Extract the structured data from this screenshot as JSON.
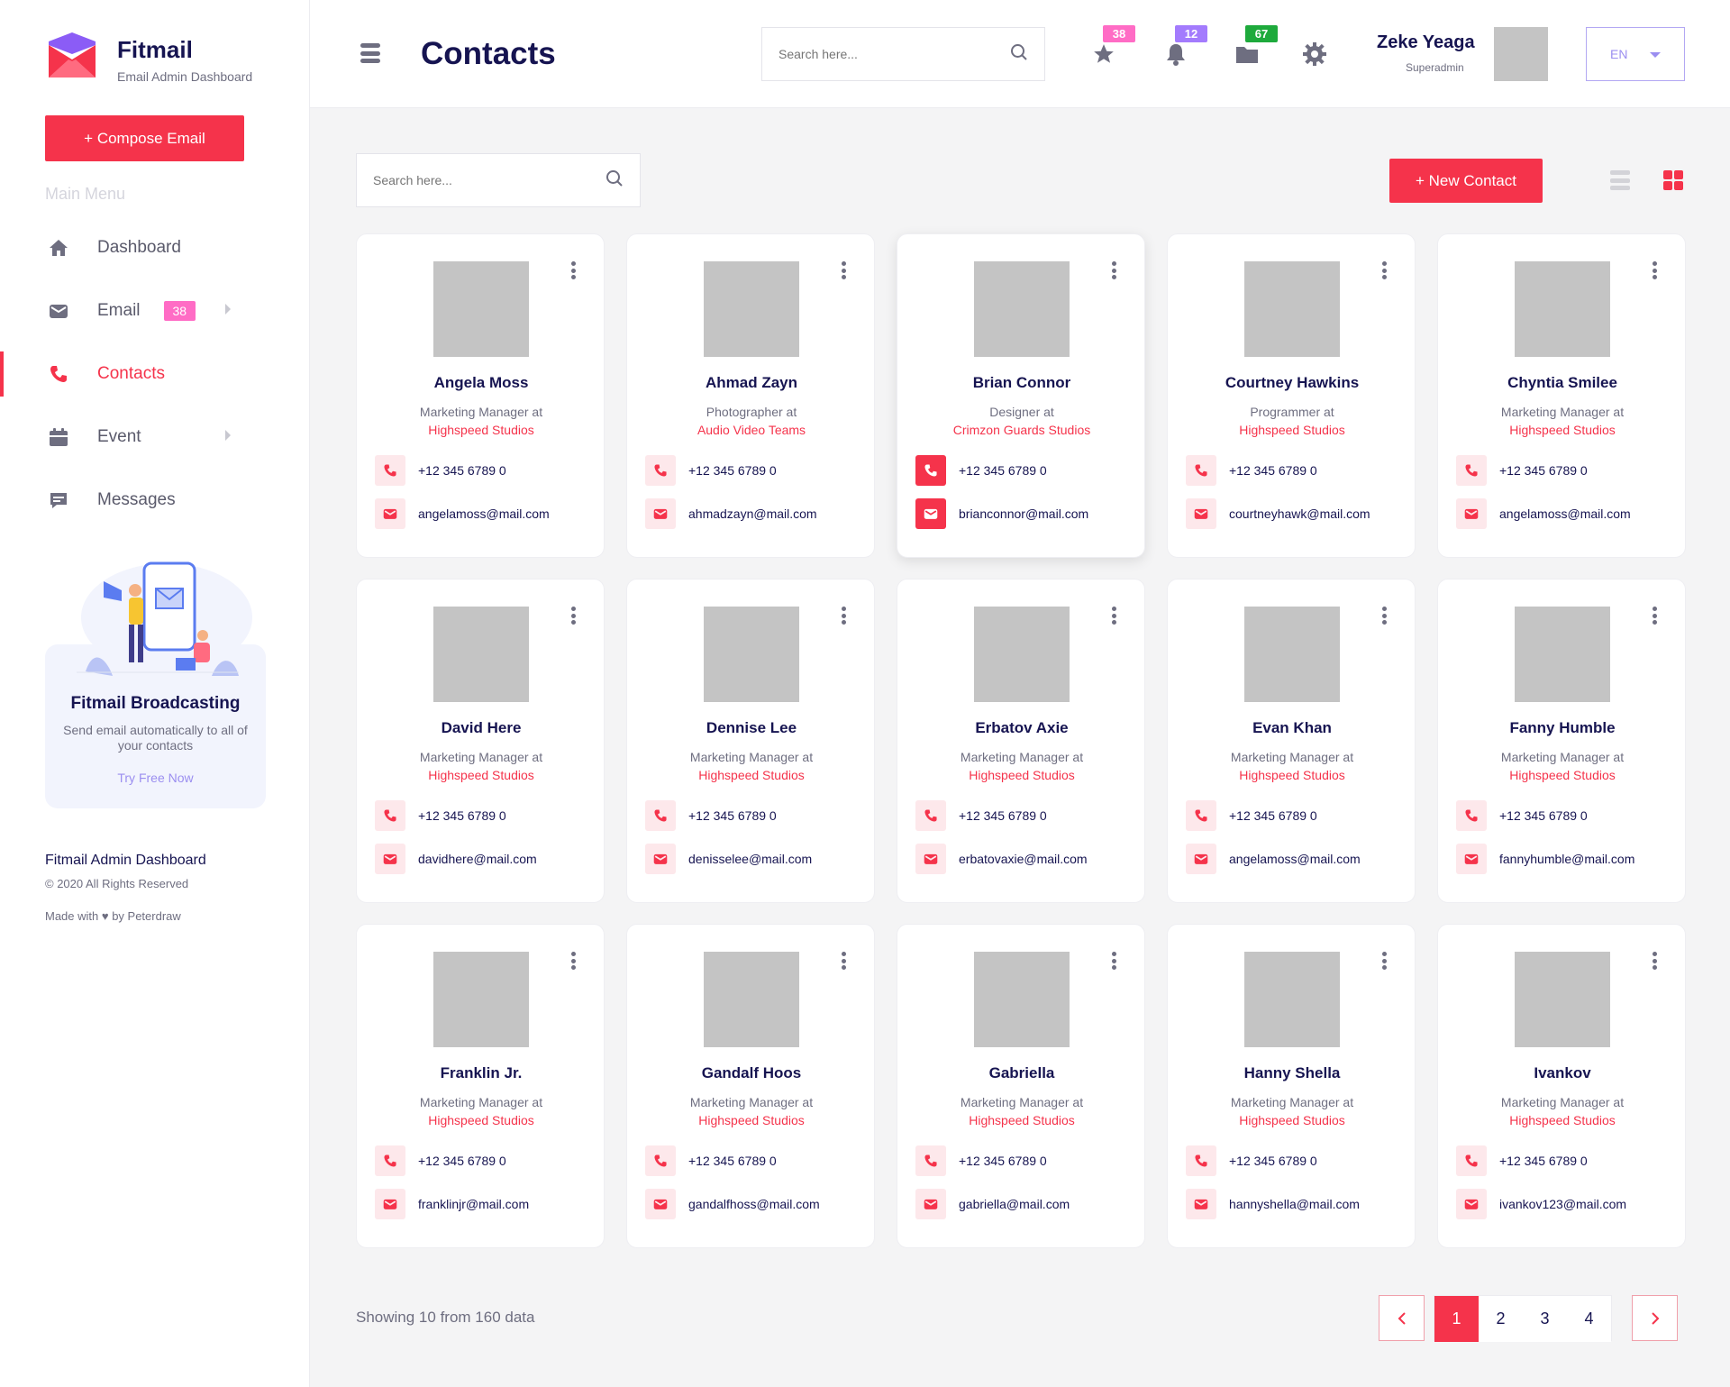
{
  "brand": {
    "name": "Fitmail",
    "subtitle": "Email Admin Dashboard"
  },
  "sidebar": {
    "compose_label": "+ Compose Email",
    "menu_title": "Main Menu",
    "items": [
      {
        "label": "Dashboard",
        "icon": "home-icon"
      },
      {
        "label": "Email",
        "icon": "mail-icon",
        "badge": "38"
      },
      {
        "label": "Contacts",
        "icon": "phone-icon",
        "active": true
      },
      {
        "label": "Event",
        "icon": "calendar-icon"
      },
      {
        "label": "Messages",
        "icon": "chat-icon"
      }
    ],
    "promo": {
      "title": "Fitmail Broadcasting",
      "text": "Send email automatically to all of your contacts",
      "link": "Try Free Now"
    },
    "footer": {
      "title": "Fitmail Admin Dashboard",
      "copyright": "© 2020 All Rights Reserved",
      "made_with": "Made with ♥ by Peterdraw"
    }
  },
  "header": {
    "title": "Contacts",
    "search_placeholder": "Search here...",
    "badges": {
      "star": "38",
      "bell": "12",
      "folder": "67"
    },
    "badge_colors": {
      "star": "#ff6cc5",
      "bell": "#a37bfd",
      "folder": "#1eaa3c"
    },
    "user_name": "Zeke Yeaga",
    "user_role": "Superadmin",
    "language": "EN"
  },
  "content": {
    "search_placeholder": "Search here...",
    "new_contact_label": "+ New Contact",
    "showing_text": "Showing 10 from 160 data"
  },
  "contacts": [
    {
      "name": "Angela Moss",
      "role": "Marketing Manager at",
      "company": "Highspeed Studios",
      "phone": "+12 345 6789 0",
      "email": "angelamoss@mail.com"
    },
    {
      "name": "Ahmad Zayn",
      "role": "Photographer at",
      "company": "Audio Video Teams",
      "phone": "+12 345 6789 0",
      "email": "ahmadzayn@mail.com"
    },
    {
      "name": "Brian Connor",
      "role": "Designer at",
      "company": "Crimzon Guards Studios",
      "phone": "+12 345 6789 0",
      "email": "brianconnor@mail.com"
    },
    {
      "name": "Courtney Hawkins",
      "role": "Programmer at",
      "company": "Highspeed Studios",
      "phone": "+12 345 6789 0",
      "email": "courtneyhawk@mail.com"
    },
    {
      "name": "Chyntia Smilee",
      "role": "Marketing Manager at",
      "company": "Highspeed Studios",
      "phone": "+12 345 6789 0",
      "email": "angelamoss@mail.com"
    },
    {
      "name": "David Here",
      "role": "Marketing Manager at",
      "company": "Highspeed Studios",
      "phone": "+12 345 6789 0",
      "email": "davidhere@mail.com"
    },
    {
      "name": "Dennise Lee",
      "role": "Marketing Manager at",
      "company": "Highspeed Studios",
      "phone": "+12 345 6789 0",
      "email": "denisselee@mail.com"
    },
    {
      "name": "Erbatov Axie",
      "role": "Marketing Manager at",
      "company": "Highspeed Studios",
      "phone": "+12 345 6789 0",
      "email": "erbatovaxie@mail.com"
    },
    {
      "name": "Evan Khan",
      "role": "Marketing Manager at",
      "company": "Highspeed Studios",
      "phone": "+12 345 6789 0",
      "email": "angelamoss@mail.com"
    },
    {
      "name": "Fanny Humble",
      "role": "Marketing Manager at",
      "company": "Highspeed Studios",
      "phone": "+12 345 6789 0",
      "email": "fannyhumble@mail.com"
    },
    {
      "name": "Franklin Jr.",
      "role": "Marketing Manager at",
      "company": "Highspeed Studios",
      "phone": "+12 345 6789 0",
      "email": "franklinjr@mail.com"
    },
    {
      "name": "Gandalf Hoos",
      "role": "Marketing Manager at",
      "company": "Highspeed Studios",
      "phone": "+12 345 6789 0",
      "email": "gandalfhoss@mail.com"
    },
    {
      "name": "Gabriella",
      "role": "Marketing Manager at",
      "company": "Highspeed Studios",
      "phone": "+12 345 6789 0",
      "email": "gabriella@mail.com"
    },
    {
      "name": "Hanny Shella",
      "role": "Marketing Manager at",
      "company": "Highspeed Studios",
      "phone": "+12 345 6789 0",
      "email": "hannyshella@mail.com"
    },
    {
      "name": "Ivankov",
      "role": "Marketing Manager at",
      "company": "Highspeed Studios",
      "phone": "+12 345 6789 0",
      "email": "ivankov123@mail.com"
    }
  ],
  "pagination": {
    "pages": [
      "1",
      "2",
      "3",
      "4"
    ],
    "active": "1"
  }
}
